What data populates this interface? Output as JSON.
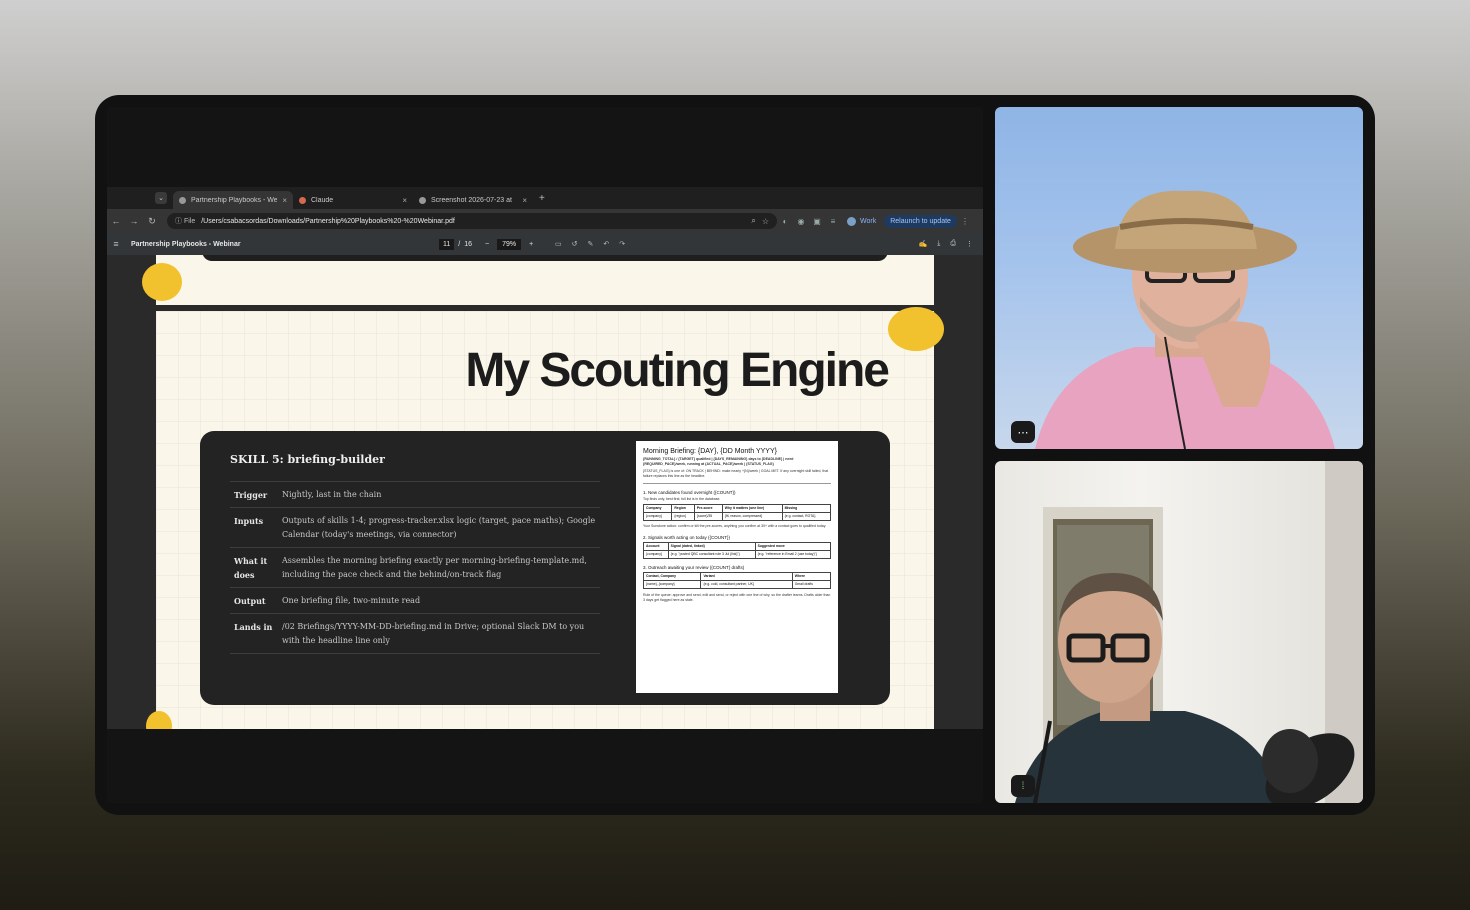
{
  "browser": {
    "tabs": [
      {
        "label": "Partnership Playbooks - Web",
        "active": true
      },
      {
        "label": "Claude",
        "active": false
      },
      {
        "label": "Screenshot 2026-07-23 at",
        "active": false
      }
    ],
    "file_chip": "File",
    "url": "/Users/csabacsordas/Downloads/Partnership%20Playbooks%20-%20Webinar.pdf",
    "profile": "Work",
    "relaunch": "Relaunch to update"
  },
  "pdf": {
    "title": "Partnership Playbooks - Webinar",
    "page_current": "11",
    "page_sep": "/",
    "page_total": "16",
    "zoom": "79%"
  },
  "slide": {
    "title": "My Scouting Engine",
    "skill_heading": "SKILL 5: briefing-builder",
    "rows": [
      {
        "key": "Trigger",
        "value": "Nightly, last in the chain"
      },
      {
        "key": "Inputs",
        "value": "Outputs of skills 1-4; progress-tracker.xlsx logic (target, pace maths); Google Calendar (today's meetings, via connector)"
      },
      {
        "key": "What it does",
        "value": "Assembles the morning briefing exactly per morning-briefing-template.md, including the pace check and the behind/on-track flag"
      },
      {
        "key": "Output",
        "value": "One briefing file, two-minute read"
      },
      {
        "key": "Lands in",
        "value": "/02 Briefings/YYYY-MM-DD-briefing.md in Drive; optional Slack DM to you with the headline line only"
      }
    ],
    "doc": {
      "heading": "Morning Briefing: {DAY}, {DD Month YYYY}",
      "sub1": "{RUNNING_TOTAL} / {TARGET} qualified | {DAYS_REMAINING} days to {DEADLINE} | need {REQUIRED_PACE}/week, running at {ACTUAL_PACE}/week | {STATUS_FLAG}",
      "sub2": "{STATUS_FLAG} is one of: ON TRACK | BEHIND: make nearly +{N}/week | GOAL MET. If any overnight skill failed, that failure replaces this line as the headline.",
      "sec1": "1. New candidates found overnight ({COUNT})",
      "sec1_note": "Top finds only, best first; full list is in the database.",
      "t1": [
        [
          "Company",
          "Region",
          "Pre-score",
          "Why it matters (one line)",
          "Missing"
        ],
        [
          "{company}",
          "{region}",
          "{score}/35",
          "{fit, reason, compressed}",
          "{e.g. contact, ROTA}"
        ]
      ],
      "sec1_after": "Your Sunstone action: confirm or kill the pre-scores, anything you confirm at 30+ with a contact goes to qualified today.",
      "sec2": "2. Signals worth acting on today ({COUNT})",
      "t2": [
        [
          "Account",
          "Signal (dated, linked)",
          "Suggested move"
        ],
        [
          "{company}",
          "{e.g. \"posted QBC consultant role 3 Jul {link}\"}",
          "{e.g. \"reference in Email 2 (use today)\"}"
        ]
      ],
      "sec3": "3. Outreach awaiting your review ({COUNT} drafts)",
      "t3": [
        [
          "Contact, Company",
          "Variant",
          "Where"
        ],
        [
          "{name}, {company}",
          "{e.g. cold, consultant partner, UK}",
          "Gmail drafts"
        ]
      ],
      "footer": "Rule of the queue: approve and send, edit and send, or reject with one line of why, so the drafter learns. Drafts older than 3 days get flagged here as stale."
    }
  },
  "participants": [
    {
      "id": "participant-1",
      "menu_icon": "more-icon"
    },
    {
      "id": "participant-2",
      "mic_icon": "mic-active-icon"
    }
  ],
  "colors": {
    "accent_yellow": "#f2c12e",
    "slide_bg": "#fbf6ea",
    "card_bg": "#232323"
  }
}
